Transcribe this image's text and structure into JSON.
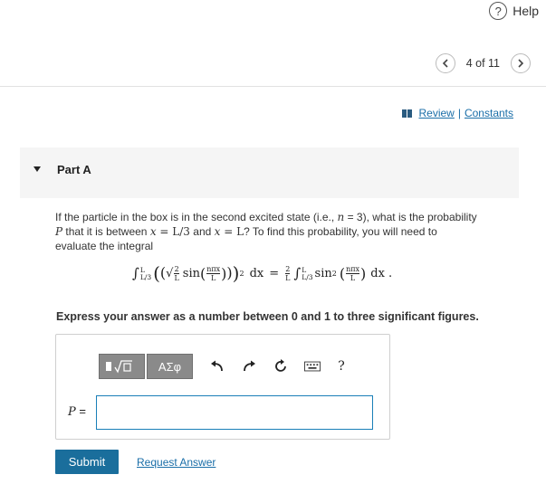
{
  "header": {
    "help_label": "Help",
    "help_glyph": "?"
  },
  "pager": {
    "text": "4 of 11",
    "prev_glyph": "‹",
    "next_glyph": "›"
  },
  "links": {
    "review": "Review",
    "separator": "|",
    "constants": "Constants"
  },
  "part": {
    "label": "Part A"
  },
  "question": {
    "line1_a": "If the particle in the box is in the second excited state (i.e., ",
    "n_var": "n",
    "line1_b": " = 3), what is the probability",
    "P_var": "P",
    "line2_a": " that it is between ",
    "x_var1": "x",
    "line2_b": " = L/3",
    "line2_c": " and ",
    "x_var2": "x",
    "line2_d": " = L",
    "line2_e": "? To find this probability, you will need to",
    "line3": "evaluate the integral"
  },
  "equation": {
    "int_sym": "∫",
    "lim_upper": "L",
    "lim_lower": "L/3",
    "lparen": "(",
    "sqrt": "√",
    "frac_num": "2",
    "frac_den": "L",
    "sin": "sin",
    "arg_num": "nπx",
    "arg_den": "L",
    "rparen": ")",
    "square": "2",
    "dx": "dx",
    "equals": "=",
    "coef_num": "2",
    "coef_den": "L",
    "sin2": "sin",
    "end": "dx ."
  },
  "instruction": "Express your answer as a number between 0 and 1 to three significant figures.",
  "toolbar": {
    "templates_label": "√□",
    "greek_label": "ΑΣφ",
    "undo_glyph": "↶",
    "redo_glyph": "↷",
    "reset_glyph": "↻",
    "help_glyph": "?"
  },
  "answer": {
    "label_var": "P",
    "label_eq": " =",
    "value": ""
  },
  "buttons": {
    "submit": "Submit",
    "request_answer": "Request Answer"
  }
}
